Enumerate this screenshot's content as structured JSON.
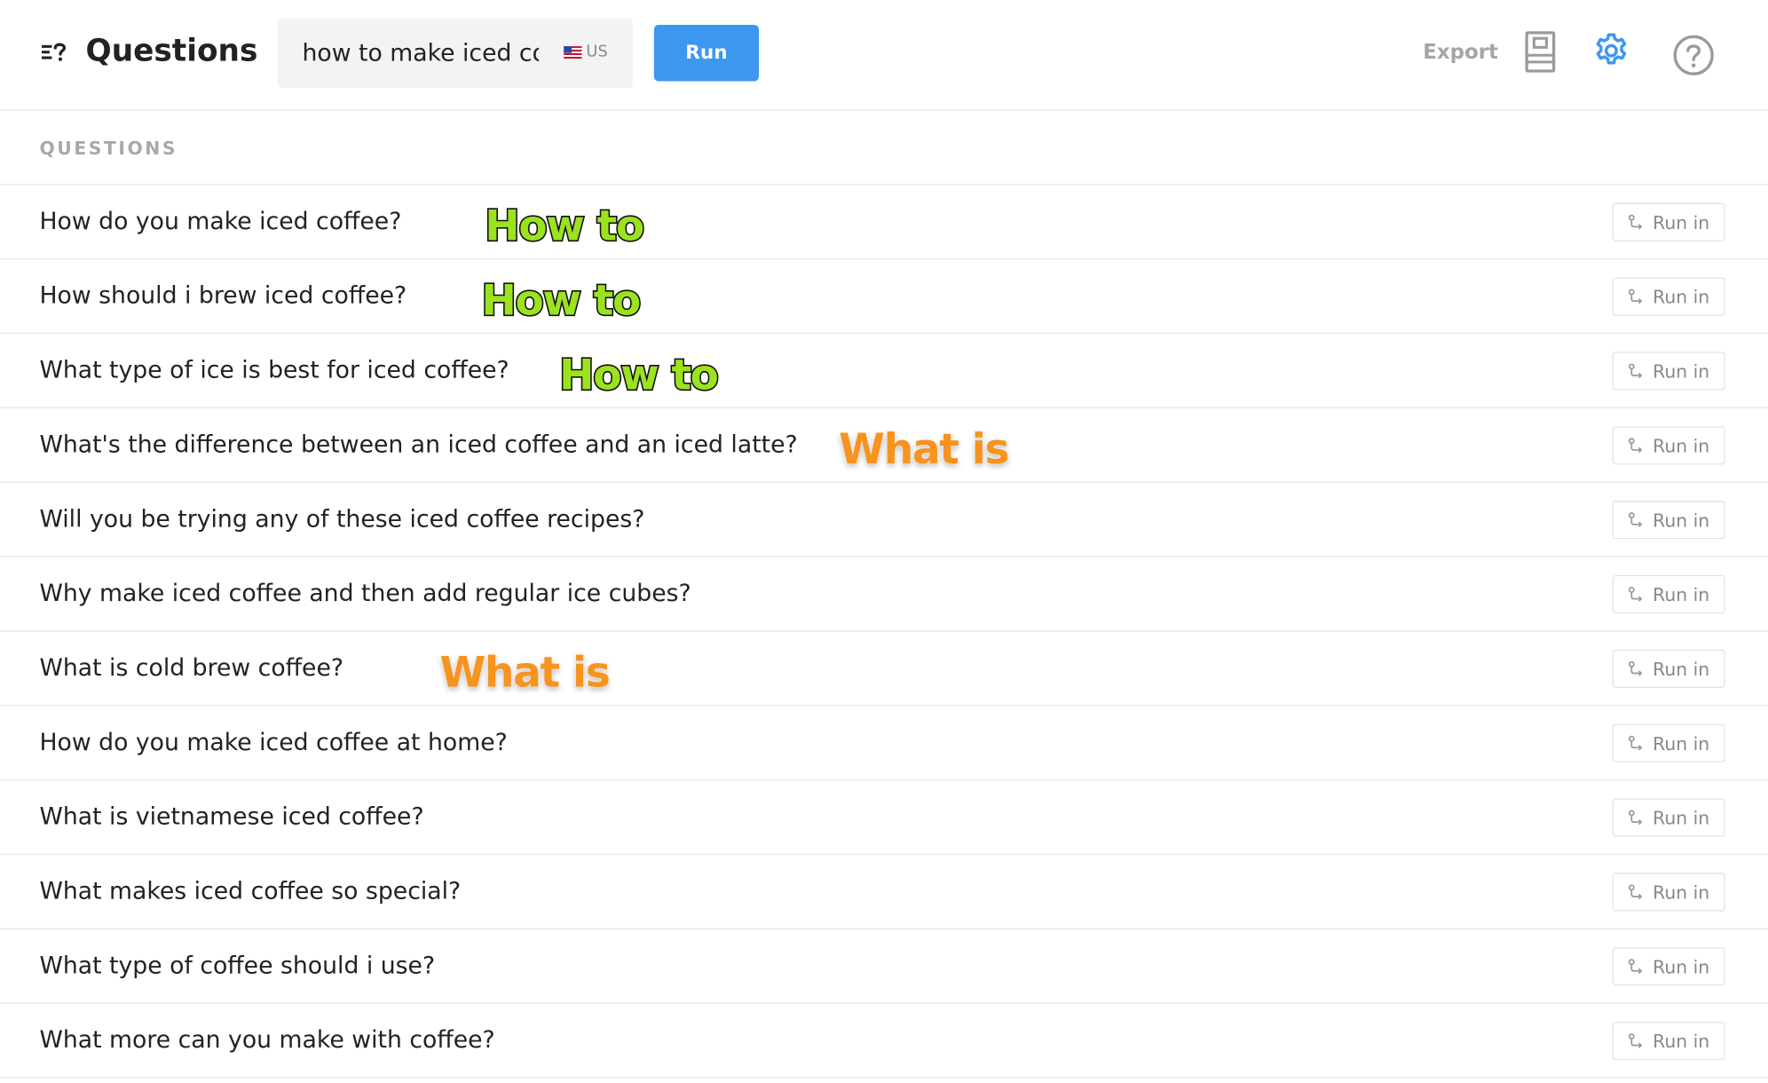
{
  "header": {
    "title": "Questions",
    "search_value": "how to make iced coffee",
    "country": "US",
    "run_label": "Run",
    "export_label": "Export"
  },
  "section": {
    "label": "QUESTIONS"
  },
  "run_in_label": "Run in",
  "questions": [
    {
      "text": "How do you make iced coffee?",
      "tag": "How to"
    },
    {
      "text": "How should i brew iced coffee?",
      "tag": "How to"
    },
    {
      "text": "What type of ice is best for iced coffee?",
      "tag": "How to"
    },
    {
      "text": "What's the difference between an iced coffee and an iced latte?",
      "tag": "What is"
    },
    {
      "text": "Will you be trying any of these iced coffee recipes?",
      "tag": ""
    },
    {
      "text": "Why make iced coffee and then add regular ice cubes?",
      "tag": ""
    },
    {
      "text": "What is cold brew coffee?",
      "tag": "What is"
    },
    {
      "text": "How do you make iced coffee at home?",
      "tag": ""
    },
    {
      "text": "What is vietnamese iced coffee?",
      "tag": ""
    },
    {
      "text": "What makes iced coffee so special?",
      "tag": ""
    },
    {
      "text": "What type of coffee should i use?",
      "tag": ""
    },
    {
      "text": "What more can you make with coffee?",
      "tag": ""
    }
  ],
  "colors": {
    "accent": "#3d97ee",
    "how_to_tag": "#9be21f",
    "what_is_tag": "#f7931e"
  },
  "icons": {
    "logo": "list-question-icon",
    "columns": "columns-icon",
    "settings": "gear-icon",
    "help": "help-circle-icon",
    "run_in": "route-icon"
  }
}
